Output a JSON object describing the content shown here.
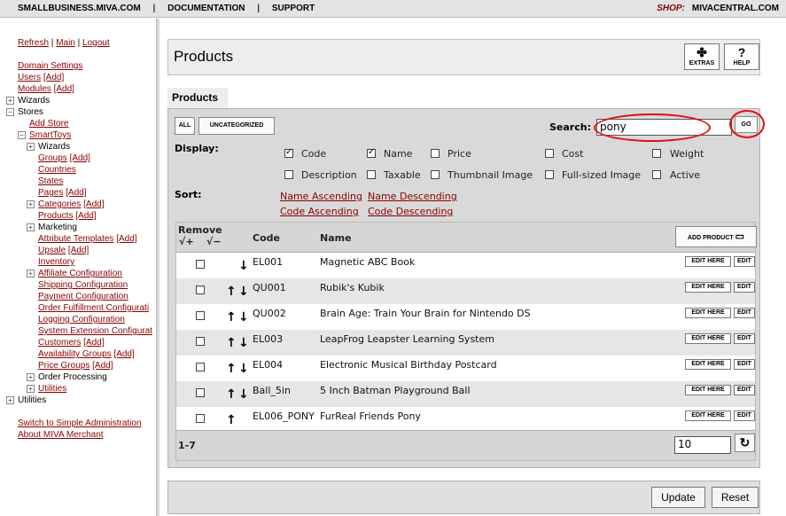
{
  "topnav": {
    "links": [
      "SMALLBUSINESS.MIVA.COM",
      "DOCUMENTATION",
      "SUPPORT"
    ],
    "separator": "|",
    "shop_label": "SHOP:",
    "shop_value": "MIVACENTRAL.COM"
  },
  "sidebar": {
    "top_links": [
      "Refresh",
      "Main",
      "Logout"
    ],
    "link_sep": "|",
    "items": [
      {
        "label": "Domain Settings"
      },
      {
        "label": "Users",
        "add": "[Add]"
      },
      {
        "label": "Modules",
        "add": "[Add]"
      },
      {
        "label": "Wizards"
      },
      {
        "label": "Stores"
      },
      {
        "label": "Add Store"
      },
      {
        "label": "SmartToys"
      },
      {
        "label": "Wizards"
      },
      {
        "label": "Groups",
        "add": "[Add]"
      },
      {
        "label": "Countries"
      },
      {
        "label": "States"
      },
      {
        "label": "Pages",
        "add": "[Add]"
      },
      {
        "label": "Categories",
        "add": "[Add]"
      },
      {
        "label": "Products",
        "add": "[Add]"
      },
      {
        "label": "Marketing"
      },
      {
        "label": "Attribute Templates",
        "add": "[Add]"
      },
      {
        "label": "Upsale",
        "add": "[Add]"
      },
      {
        "label": "Inventory"
      },
      {
        "label": "Affiliate Configuration"
      },
      {
        "label": "Shipping Configuration"
      },
      {
        "label": "Payment Configuration"
      },
      {
        "label": "Order Fulfillment Configurati"
      },
      {
        "label": "Logging Configuration"
      },
      {
        "label": "System Extension Configurat"
      },
      {
        "label": "Customers",
        "add": "[Add]"
      },
      {
        "label": "Availability Groups",
        "add": "[Add]"
      },
      {
        "label": "Price Groups",
        "add": "[Add]"
      },
      {
        "label": "Order Processing"
      },
      {
        "label": "Utilities"
      },
      {
        "label": "Utilities"
      },
      {
        "label": "Switch to Simple Administration"
      },
      {
        "label": "About MIVA Merchant"
      }
    ]
  },
  "header": {
    "title": "Products",
    "extras_label": "EXTRAS",
    "help_label": "HELP",
    "help_glyph": "?"
  },
  "tab": {
    "label": "Products"
  },
  "filters": {
    "all_label": "ALL",
    "uncategorized_label": "UNCATEGORIZED",
    "search_label": "Search:",
    "search_value": "pony",
    "go_label": "GO",
    "display_label": "Display:",
    "sort_label": "Sort:",
    "display_options": [
      {
        "label": "Code",
        "checked": true
      },
      {
        "label": "Name",
        "checked": true
      },
      {
        "label": "Price",
        "checked": false
      },
      {
        "label": "Cost",
        "checked": false
      },
      {
        "label": "Weight",
        "checked": false
      },
      {
        "label": "Description",
        "checked": false
      },
      {
        "label": "Taxable",
        "checked": false
      },
      {
        "label": "Thumbnail Image",
        "checked": false
      },
      {
        "label": "Full-sized Image",
        "checked": false
      },
      {
        "label": "Active",
        "checked": false
      }
    ],
    "sort_options": [
      "Name Ascending",
      "Name Descending",
      "Code Ascending",
      "Code Descending"
    ]
  },
  "table": {
    "remove_label": "Remove",
    "check_plus": "√+",
    "check_minus": "√−",
    "code_header": "Code",
    "name_header": "Name",
    "add_product_label": "ADD PRODUCT",
    "edit_here_label": "EDIT HERE",
    "edit_label": "EDIT",
    "rows": [
      {
        "code": "EL001",
        "name": "Magnetic ABC Book",
        "up": false,
        "down": true
      },
      {
        "code": "QU001",
        "name": "Rubik's Kubik",
        "up": true,
        "down": true
      },
      {
        "code": "QU002",
        "name": "Brain Age: Train Your Brain for Nintendo DS",
        "up": true,
        "down": true
      },
      {
        "code": "EL003",
        "name": "LeapFrog Leapster Learning System",
        "up": true,
        "down": true
      },
      {
        "code": "EL004",
        "name": "Electronic Musical Birthday Postcard",
        "up": true,
        "down": true
      },
      {
        "code": "Ball_5in",
        "name": "5 Inch Batman Playground Ball",
        "up": true,
        "down": true
      },
      {
        "code": "EL006_PONY",
        "name": "FurReal Friends Pony",
        "up": true,
        "down": false
      }
    ],
    "range": "1-7",
    "per_page": "10"
  },
  "actions": {
    "update_label": "Update",
    "reset_label": "Reset"
  },
  "colors": {
    "link": "#8b0000",
    "highlight_circle": "#e01010"
  }
}
